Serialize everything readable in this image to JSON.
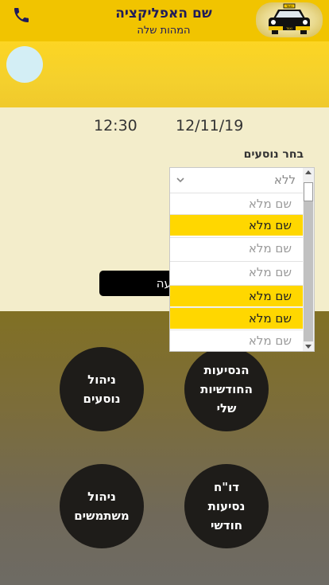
{
  "header": {
    "app_name": "שם האפליקציה",
    "subtitle": "המהות שלה",
    "phone_icon": "phone-icon",
    "logo_icon": "taxi-icon",
    "logo_sign": "TAXI",
    "logo_plate": "TAXI"
  },
  "trip": {
    "date": "12/11/19",
    "time": "12:30"
  },
  "passengers": {
    "label": "בחר נוסעים",
    "selected": "ללא",
    "options": [
      "שם מלא",
      "שם מלא",
      "שם מלא",
      "שם מלא",
      "שם מלא",
      "שם מלא",
      "שם מלא"
    ],
    "highlighted": [
      false,
      true,
      false,
      false,
      true,
      true,
      false
    ]
  },
  "order_button": {
    "label": "נסיעה"
  },
  "menu": {
    "my_monthly_trips": "הנסיעות החודשיות שלי",
    "passengers_mgmt": "ניהול נוסעים",
    "monthly_report": "דו\"ח נסיעות חודשי",
    "users_mgmt": "ניהול משתמשים"
  },
  "colors": {
    "header": "#f1c400",
    "highlight": "#ffd700",
    "title": "#1f1b5a"
  }
}
